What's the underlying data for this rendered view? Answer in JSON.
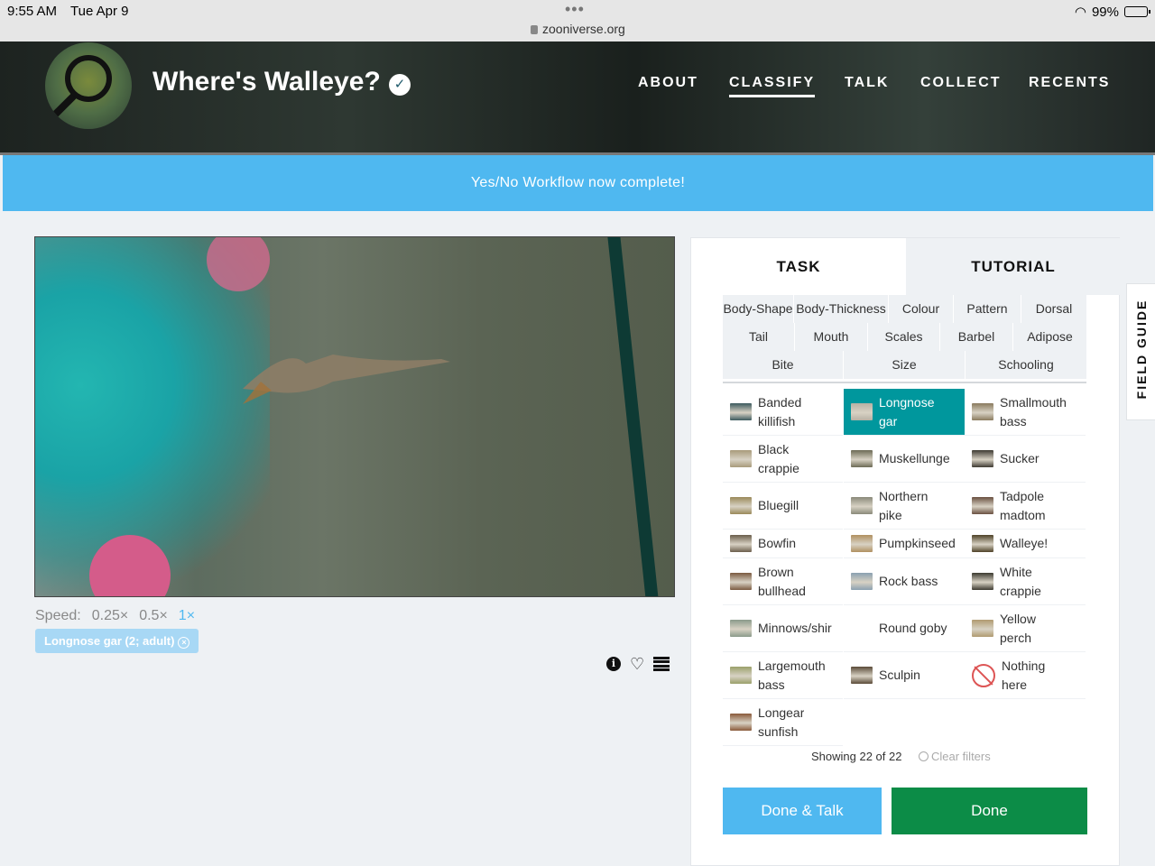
{
  "status_bar": {
    "time": "9:55 AM",
    "date": "Tue Apr 9",
    "url": "zooniverse.org",
    "battery": "99%"
  },
  "header": {
    "title": "Where's Walleye?",
    "nav": [
      "ABOUT",
      "CLASSIFY",
      "TALK",
      "COLLECT",
      "RECENTS"
    ],
    "active_nav": "CLASSIFY"
  },
  "banner": {
    "text": "Yes/No Workflow now complete!"
  },
  "player": {
    "speed_label": "Speed:",
    "speeds": [
      "0.25×",
      "0.5×",
      "1×"
    ],
    "selected_speed": "1×",
    "annotation_tag": "Longnose gar (2; adult)"
  },
  "task_panel": {
    "tabs": [
      "TASK",
      "TUTORIAL"
    ],
    "filters_row1": [
      "Body-Shape",
      "Body-Thickness",
      "Colour",
      "Pattern",
      "Dorsal"
    ],
    "filters_row2": [
      "Tail",
      "Mouth",
      "Scales",
      "Barbel",
      "Adipose"
    ],
    "filters_row3": [
      "Bite",
      "Size",
      "Schooling"
    ],
    "species": [
      {
        "label": "Banded killifish",
        "lines": [
          "Banded",
          "killifish"
        ],
        "color": "#3c5a5e"
      },
      {
        "label": "Longnose gar",
        "lines": [
          "Longnose",
          "gar"
        ],
        "color": "#b7b1a4",
        "selected": true
      },
      {
        "label": "Smallmouth bass",
        "lines": [
          "Smallmouth",
          "bass"
        ],
        "color": "#8a7a5e"
      },
      {
        "label": "Black crappie",
        "lines": [
          "Black",
          "crappie"
        ],
        "color": "#a89a7a"
      },
      {
        "label": "Muskellunge",
        "lines": [
          "Muskellunge"
        ],
        "color": "#6c6a55"
      },
      {
        "label": "Sucker",
        "lines": [
          "Sucker"
        ],
        "color": "#3e3a32"
      },
      {
        "label": "Bluegill",
        "lines": [
          "Bluegill"
        ],
        "color": "#9a8a5a"
      },
      {
        "label": "Northern pike",
        "lines": [
          "Northern",
          "pike"
        ],
        "color": "#8a8a7a"
      },
      {
        "label": "Tadpole madtom",
        "lines": [
          "Tadpole",
          "madtom"
        ],
        "color": "#6a5040"
      },
      {
        "label": "Bowfin",
        "lines": [
          "Bowfin"
        ],
        "color": "#6b5e4c"
      },
      {
        "label": "Pumpkinseed",
        "lines": [
          "Pumpkinseed"
        ],
        "color": "#b09060"
      },
      {
        "label": "Walleye!",
        "lines": [
          "Walleye!"
        ],
        "color": "#4e4228"
      },
      {
        "label": "Brown bullhead",
        "lines": [
          "Brown",
          "bullhead"
        ],
        "color": "#7a5a40"
      },
      {
        "label": "Rock bass",
        "lines": [
          "Rock bass"
        ],
        "color": "#8aa0b0"
      },
      {
        "label": "White crappie",
        "lines": [
          "White",
          "crappie"
        ],
        "color": "#3c3a30"
      },
      {
        "label": "Minnows/shiners",
        "lines": [
          "Minnows/shir"
        ],
        "color": "#8a9a8a"
      },
      {
        "label": "Round goby",
        "lines": [
          "Round goby"
        ],
        "color": "none"
      },
      {
        "label": "Yellow perch",
        "lines": [
          "Yellow",
          "perch"
        ],
        "color": "#b09a70"
      },
      {
        "label": "Largemouth bass",
        "lines": [
          "Largemouth",
          "bass"
        ],
        "color": "#9aa06a"
      },
      {
        "label": "Sculpin",
        "lines": [
          "Sculpin"
        ],
        "color": "#5a4a38"
      },
      {
        "label": "Nothing here",
        "lines": [
          "Nothing",
          "here"
        ],
        "color": "nothing"
      },
      {
        "label": "Longear sunfish",
        "lines": [
          "Longear",
          "sunfish"
        ],
        "color": "#8a5a3a"
      }
    ],
    "showing": "Showing 22 of 22",
    "clear_filters": "Clear filters",
    "done_talk": "Done & Talk",
    "done": "Done"
  },
  "field_guide": "FIELD GUIDE"
}
